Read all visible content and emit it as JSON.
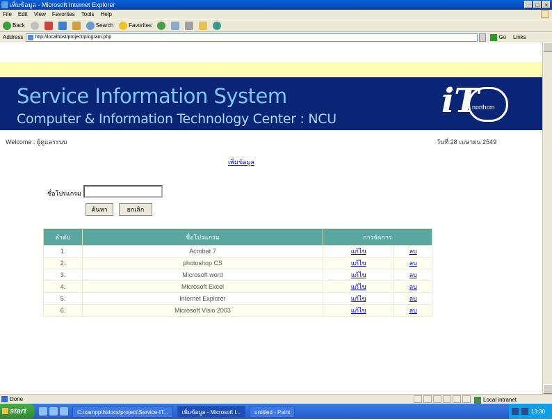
{
  "window": {
    "title": "เพิ่มข้อมูล - Microsoft Internet Explorer",
    "min": "_",
    "max": "□",
    "close": "×"
  },
  "menu": [
    "File",
    "Edit",
    "View",
    "Favorites",
    "Tools",
    "Help"
  ],
  "toolbar": {
    "back": "Back",
    "search": "Search",
    "favorites": "Favorites"
  },
  "address": {
    "label": "Address",
    "url": "http://localhost/project/program.php",
    "go": "Go",
    "links": "Links"
  },
  "banner": {
    "title": "Service Information System",
    "subtitle": "Computer & Information Technology Center : NCU",
    "logo_main": "iT",
    "logo_sub": "northcm"
  },
  "page": {
    "welcome": "Welcome : ผู้ดูแลระบบ",
    "date": "วันที่ 28 เมษายน 2549",
    "add_link": "เพิ่มข้อมูล",
    "search_label": "ชื่อโปรแกรม",
    "search_value": "",
    "search_button": "ค้นหา",
    "cancel_button": "ยกเลิก"
  },
  "table": {
    "headers": [
      "ลำดับ",
      "ชื่อโปรแกรม",
      "การจัดการ"
    ],
    "rows": [
      {
        "no": "1.",
        "name": "Acrobat 7",
        "edit": "แก้ไข",
        "del": "ลบ"
      },
      {
        "no": "2.",
        "name": "photoshop CS",
        "edit": "แก้ไข",
        "del": "ลบ"
      },
      {
        "no": "3.",
        "name": "Microsoft word",
        "edit": "แก้ไข",
        "del": "ลบ"
      },
      {
        "no": "4.",
        "name": "Microsoft Excel",
        "edit": "แก้ไข",
        "del": "ลบ"
      },
      {
        "no": "5.",
        "name": "Internet Explorer",
        "edit": "แก้ไข",
        "del": "ลบ"
      },
      {
        "no": "6.",
        "name": "Microsoft Visio 2003",
        "edit": "แก้ไข",
        "del": "ลบ"
      }
    ]
  },
  "status": {
    "text": "Done",
    "zone": "Local intranet"
  },
  "taskbar": {
    "start": "start",
    "tasks": [
      "C:\\xampp\\htdocs\\project\\Service-IT...",
      "เพิ่มข้อมูล - Microsoft I...",
      "untitled - Paint"
    ],
    "clock": "13:30"
  },
  "colors": {
    "banner_bg": "#0a2575",
    "table_header": "#5aa6a0",
    "title_text": "#7ec8ff"
  }
}
